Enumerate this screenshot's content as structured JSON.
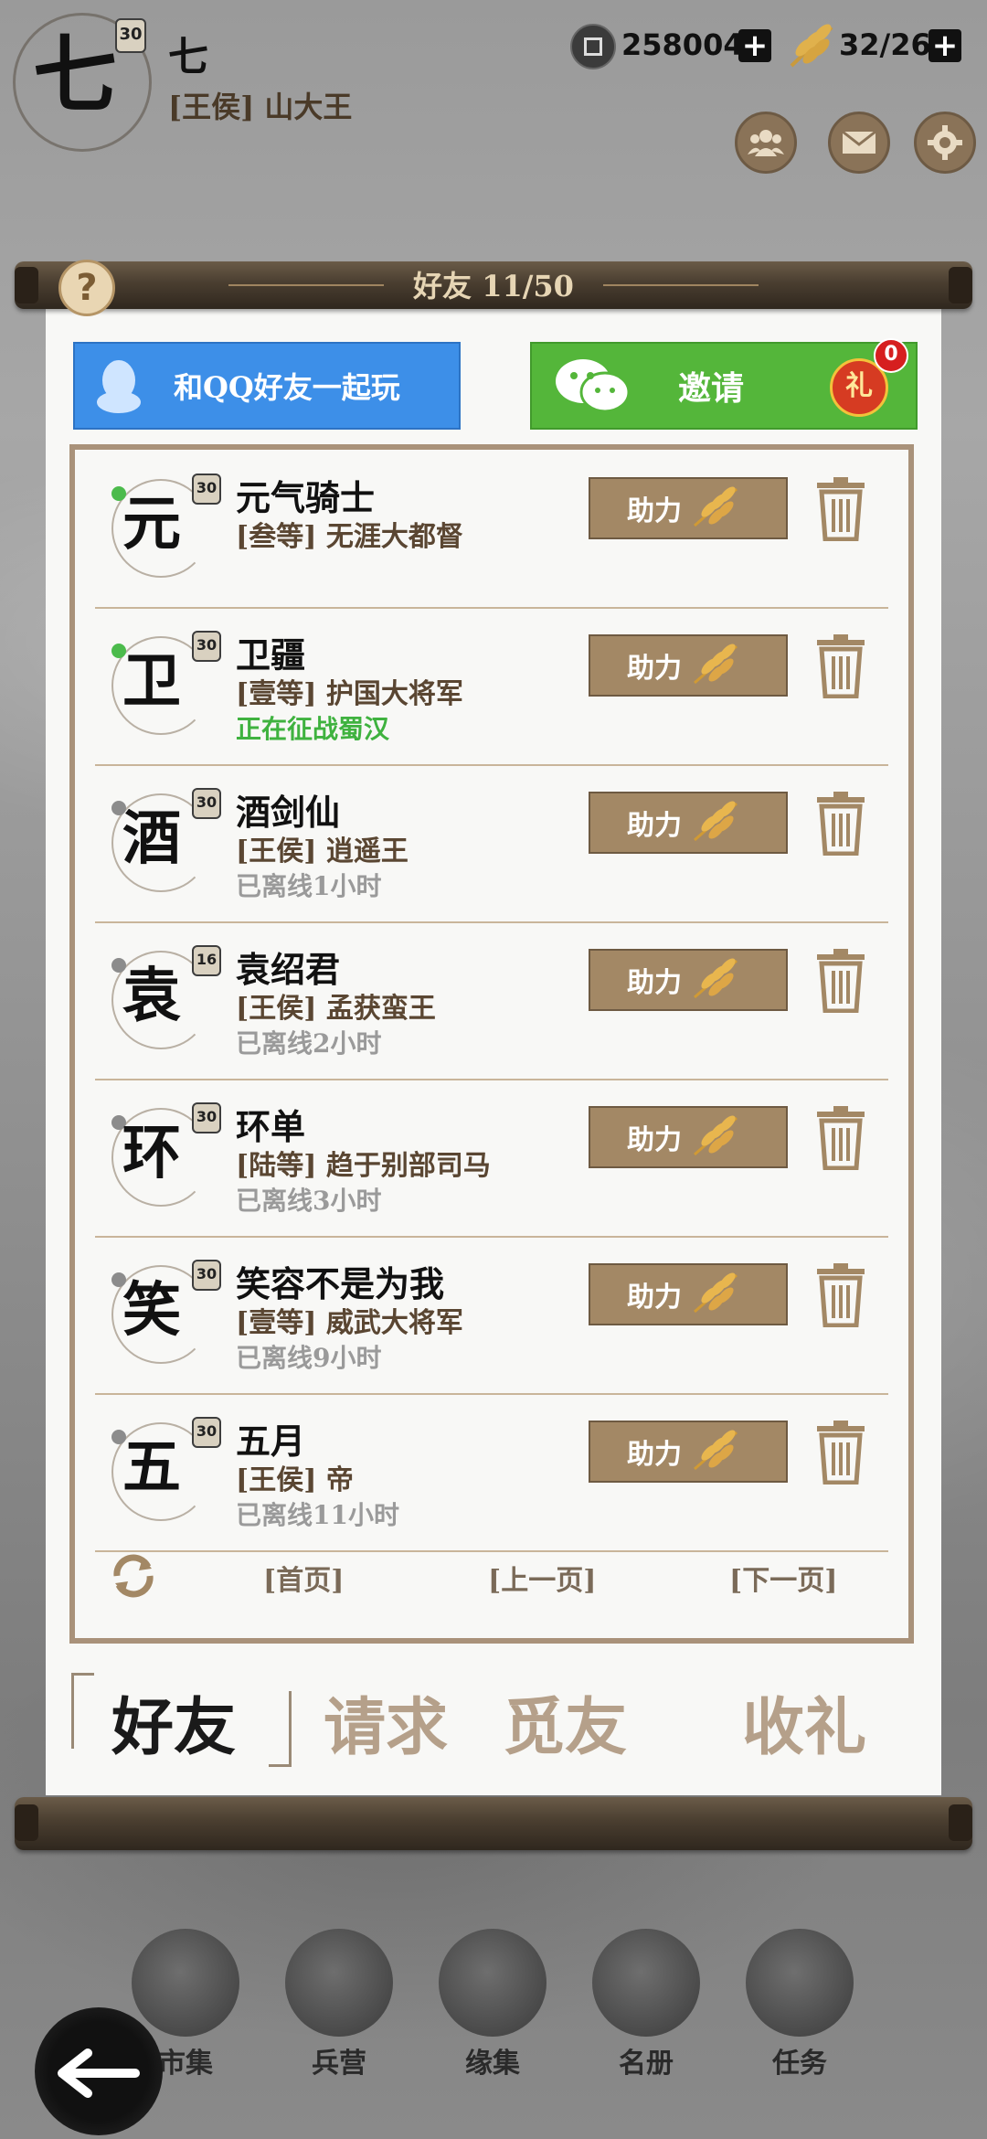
{
  "header": {
    "avatar_glyph": "七",
    "avatar_level": "30",
    "player_name": "七",
    "player_title": "[王侯] 山大王",
    "coins": "258004",
    "grain": "32/26",
    "icons": [
      "coin-icon",
      "wheat-icon",
      "friends-icon",
      "mail-icon",
      "settings-icon"
    ]
  },
  "panel": {
    "title": "好友 11/50",
    "qq_button": "和QQ好友一起玩",
    "invite_button": "邀请",
    "gift_badge": "0",
    "gift_text": "礼"
  },
  "friends": [
    {
      "glyph": "元",
      "level": "30",
      "name": "元气骑士",
      "title": "[叁等] 无涯大都督",
      "status": "",
      "online": true
    },
    {
      "glyph": "卫",
      "level": "30",
      "name": "卫疆",
      "title": "[壹等] 护国大将军",
      "status": "正在征战蜀汉",
      "online": true
    },
    {
      "glyph": "酒",
      "level": "30",
      "name": "酒剑仙",
      "title": "[王侯] 逍遥王",
      "status": "已离线1小时",
      "online": false
    },
    {
      "glyph": "袁",
      "level": "16",
      "name": "袁绍君",
      "title": "[王侯] 孟获蛮王",
      "status": "已离线2小时",
      "online": false
    },
    {
      "glyph": "环",
      "level": "30",
      "name": "环单",
      "title": "[陆等] 趋于别部司马",
      "status": "已离线3小时",
      "online": false
    },
    {
      "glyph": "笑",
      "level": "30",
      "name": "笑容不是为我",
      "title": "[壹等] 威武大将军",
      "status": "已离线9小时",
      "online": false
    },
    {
      "glyph": "五",
      "level": "30",
      "name": "五月",
      "title": "[王侯] 帝",
      "status": "已离线11小时",
      "online": false
    }
  ],
  "help_label": "助力",
  "pager": {
    "first": "[首页]",
    "prev": "[上一页]",
    "next": "[下一页]"
  },
  "tabs": [
    "好友",
    "请求",
    "觅友",
    "收礼"
  ],
  "bottom_nav": [
    "市集",
    "兵营",
    "缘集",
    "名册",
    "任务"
  ],
  "colors": {
    "online": "#4cbb4c",
    "offline": "#8c8c8c",
    "online_status": "#3fb23f",
    "offline_status": "#9a9a9a",
    "accent": "#a38865"
  }
}
